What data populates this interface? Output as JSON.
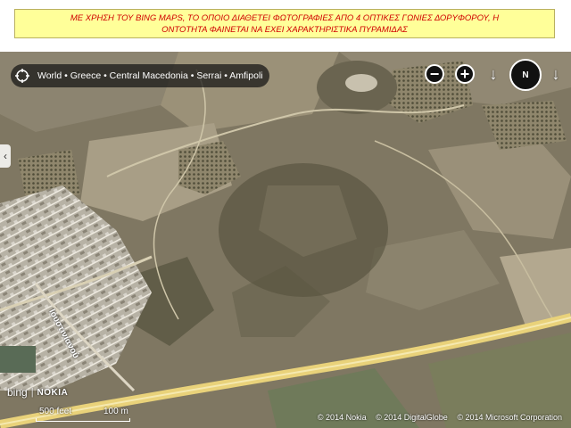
{
  "banner": {
    "line1": "ΜΕ ΧΡΗΣΗ ΤΟΥ BING MAPS, ΤΟ ΟΠΟΙΟ ΔΙΑΘΕΤΕΙ ΦΩΤΟΓΡΑΦΙΕΣ ΑΠΟ 4 ΟΠΤΙΚΕΣ ΓΩΝΙΕΣ ΔΟΡΥΦΟΡΟΥ, Η",
    "line2": "ΟΝΤΟΤΗΤΑ ΦΑΙΝΕΤΑΙ ΝΑ ΕΧΕΙ ΧΑΡΑΚΤΗΡΙΣΤΙΚΑ ΠΥΡΑΜΙΔΑΣ"
  },
  "map": {
    "breadcrumb": "World • Greece • Central Macedonia • Serrai • Amfipoli",
    "controls": {
      "zoom_out": "−",
      "zoom_in": "+",
      "compass": "N",
      "rotate_left": "↓",
      "rotate_right": "↓",
      "side_tab": "‹"
    },
    "road_label": "Ιουστινιανού",
    "logos": {
      "bing": "bing",
      "sep": "|",
      "nokia": "NOKIA"
    },
    "scale": {
      "feet": "500 feet",
      "meters": "100 m"
    },
    "copyright": [
      "© 2014 Nokia",
      "© 2014 DigitalGlobe",
      "© 2014 Microsoft Corporation"
    ]
  },
  "icons": [
    "globe-icon",
    "zoom-out-icon",
    "zoom-in-icon",
    "compass-icon",
    "rotate-left-icon",
    "rotate-right-icon",
    "chevron-left-icon"
  ],
  "colors": {
    "banner_bg": "#ffff99",
    "banner_text": "#d00000",
    "road": "#e9d27a"
  }
}
